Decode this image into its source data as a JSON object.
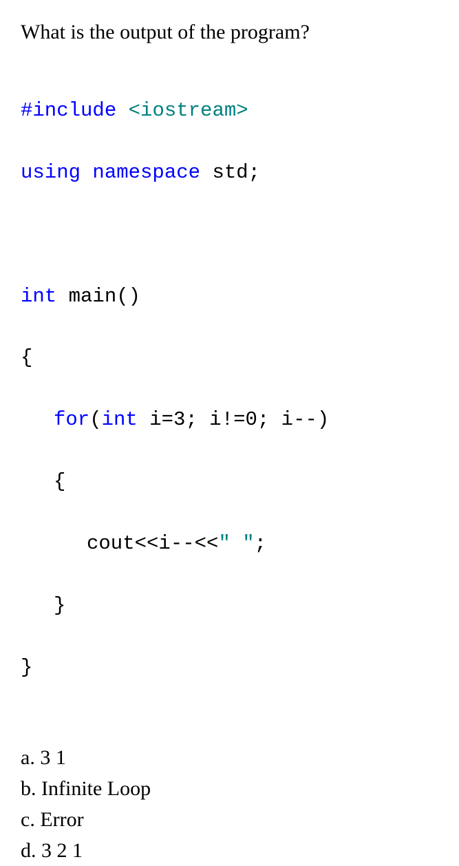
{
  "question": "What is the output of the program?",
  "code": {
    "l1a": "#include ",
    "l1b": "<iostream>",
    "l2a": "using ",
    "l2b": "namespace ",
    "l2c": "std;",
    "l3a": "int ",
    "l3b": "main()",
    "l4": "{",
    "l5a": "for",
    "l5b": "(",
    "l5c": "int ",
    "l5d": "i=3; i!=0; i--)",
    "l6": "{",
    "l7a": "cout<<i--<<",
    "l7b": "\" \"",
    "l7c": ";",
    "l8": "}",
    "l9": "}"
  },
  "answers": {
    "a_label": "a. ",
    "a_text": "3 1",
    "b_label": "b. ",
    "b_text": "Infinite Loop",
    "c_label": "c. ",
    "c_text": "Error",
    "d_label": "d. ",
    "d_text": "3 2 1"
  }
}
